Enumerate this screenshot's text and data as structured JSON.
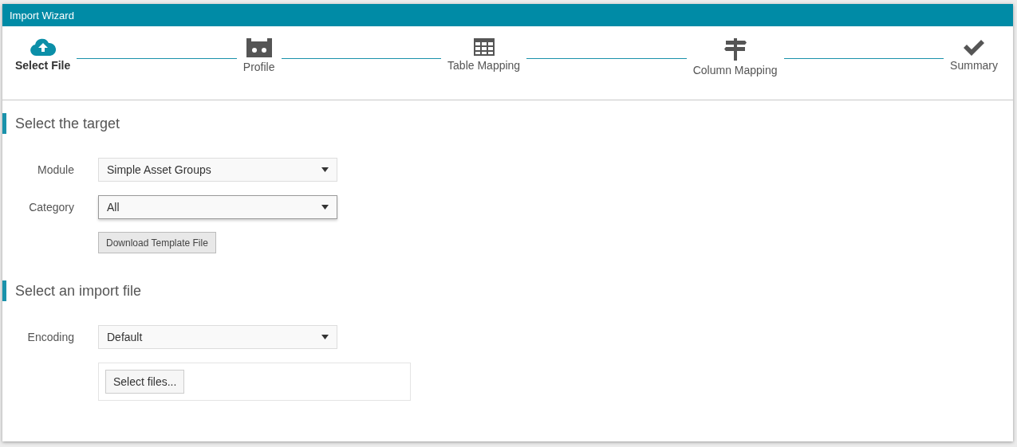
{
  "window": {
    "title": "Import Wizard"
  },
  "steps": [
    {
      "label": "Select File",
      "kind": "upload",
      "selected": true
    },
    {
      "label": "Profile",
      "kind": "profile",
      "selected": false
    },
    {
      "label": "Table Mapping",
      "kind": "table",
      "selected": false
    },
    {
      "label": "Column Mapping",
      "kind": "signpost",
      "selected": false
    },
    {
      "label": "Summary",
      "kind": "check",
      "selected": false
    }
  ],
  "sections": [
    {
      "title": "Select the target",
      "fields": [
        {
          "kind": "select",
          "label": "Module",
          "value": "Simple Asset Groups",
          "focused": false
        },
        {
          "kind": "select",
          "label": "Category",
          "value": "All",
          "focused": true
        },
        {
          "kind": "button",
          "label": "Download Template File"
        }
      ]
    },
    {
      "title": "Select an import file",
      "fields": [
        {
          "kind": "select",
          "label": "Encoding",
          "value": "Default",
          "focused": false
        },
        {
          "kind": "upload",
          "label": "Select files..."
        }
      ]
    }
  ]
}
